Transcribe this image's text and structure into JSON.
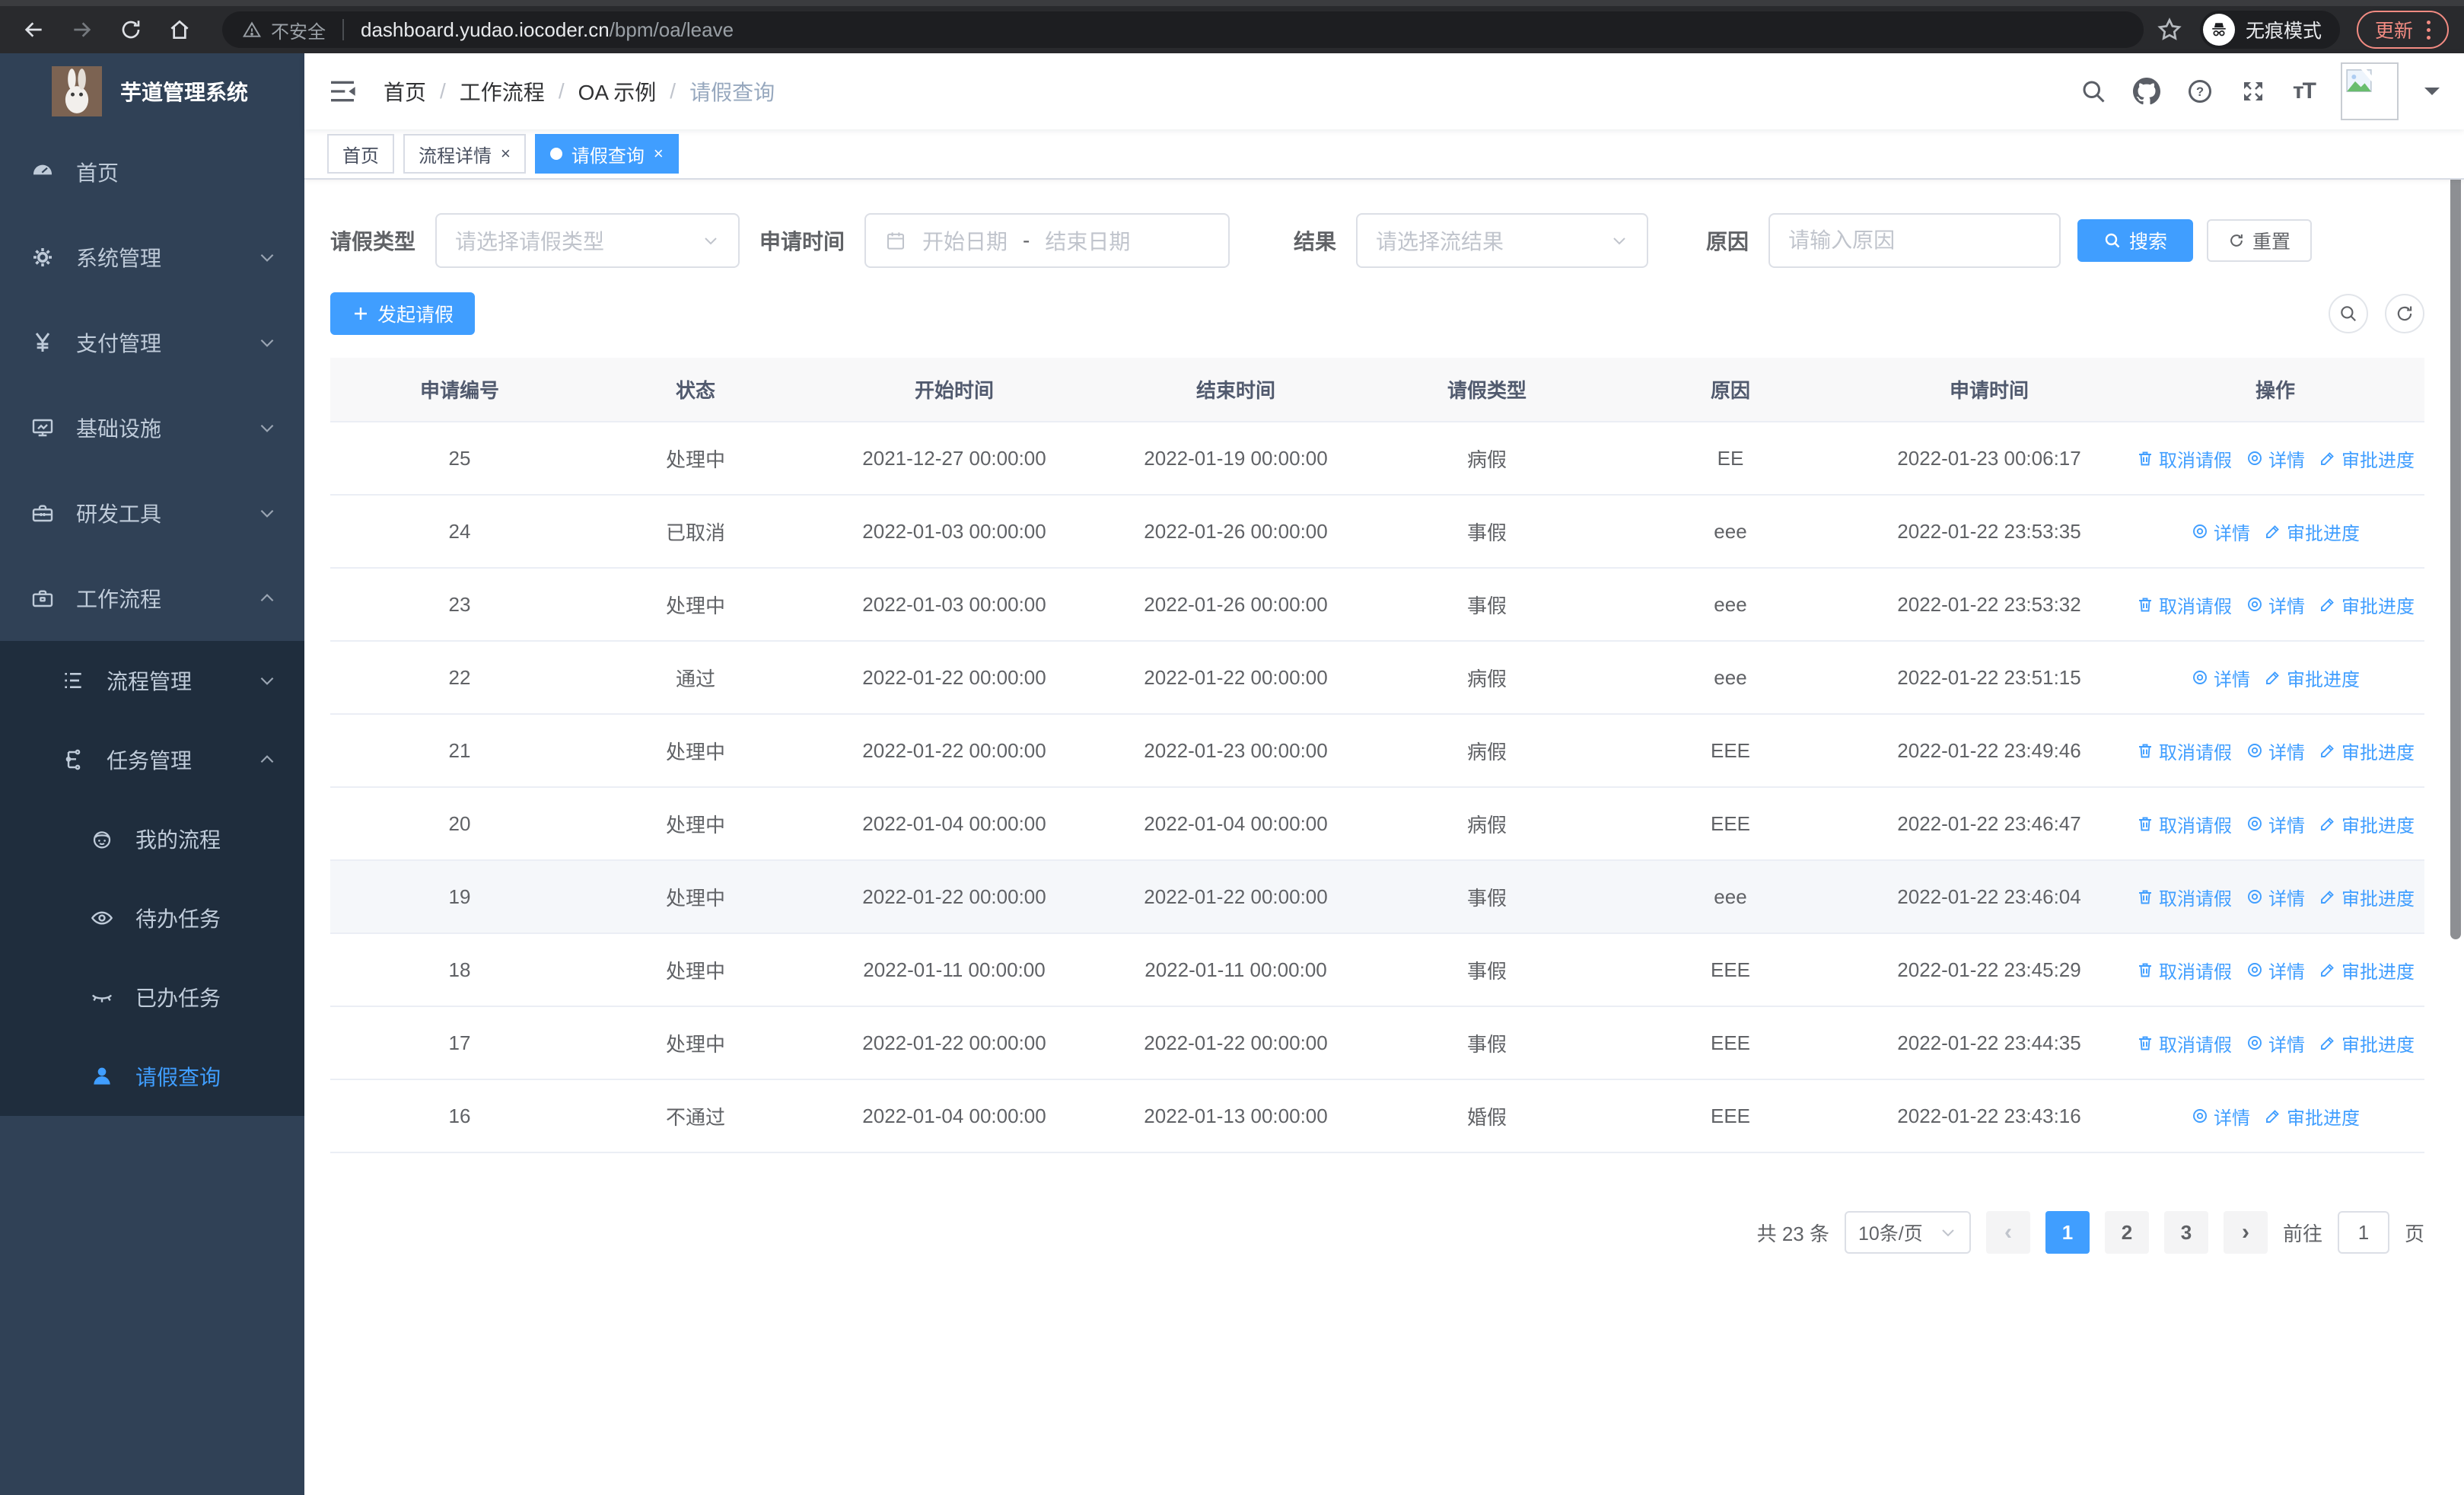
{
  "browser": {
    "security_label": "不安全",
    "url_host": "dashboard.yudao.iocoder.cn",
    "url_path": "/bpm/oa/leave",
    "incognito_label": "无痕模式",
    "update_label": "更新"
  },
  "sidebar": {
    "app_title": "芋道管理系统",
    "items": [
      {
        "label": "首页",
        "icon": "gauge",
        "level": 1,
        "chevron": "",
        "active": false
      },
      {
        "label": "系统管理",
        "icon": "gear",
        "level": 1,
        "chevron": "down",
        "active": false
      },
      {
        "label": "支付管理",
        "icon": "yen",
        "level": 1,
        "chevron": "down",
        "active": false
      },
      {
        "label": "基础设施",
        "icon": "monitor",
        "level": 1,
        "chevron": "down",
        "active": false
      },
      {
        "label": "研发工具",
        "icon": "toolbox",
        "level": 1,
        "chevron": "down",
        "active": false
      },
      {
        "label": "工作流程",
        "icon": "briefcase",
        "level": 1,
        "chevron": "up",
        "active": false
      },
      {
        "label": "流程管理",
        "icon": "list",
        "level": 2,
        "chevron": "down",
        "active": false
      },
      {
        "label": "任务管理",
        "icon": "tree",
        "level": 2,
        "chevron": "up",
        "active": false
      },
      {
        "label": "我的流程",
        "icon": "robot",
        "level": 3,
        "chevron": "",
        "active": false
      },
      {
        "label": "待办任务",
        "icon": "eye",
        "level": 3,
        "chevron": "",
        "active": false
      },
      {
        "label": "已办任务",
        "icon": "eye-closed",
        "level": 3,
        "chevron": "",
        "active": false
      },
      {
        "label": "请假查询",
        "icon": "user",
        "level": 3,
        "chevron": "",
        "active": true
      }
    ]
  },
  "breadcrumb": [
    "首页",
    "工作流程",
    "OA 示例",
    "请假查询"
  ],
  "tabs": [
    {
      "label": "首页",
      "closable": false,
      "active": false
    },
    {
      "label": "流程详情",
      "closable": true,
      "active": false
    },
    {
      "label": "请假查询",
      "closable": true,
      "active": true
    }
  ],
  "filters": {
    "leave_type_label": "请假类型",
    "leave_type_placeholder": "请选择请假类型",
    "apply_time_label": "申请时间",
    "date_start_placeholder": "开始日期",
    "date_separator": "-",
    "date_end_placeholder": "结束日期",
    "result_label": "结果",
    "result_placeholder": "请选择流结果",
    "reason_label": "原因",
    "reason_placeholder": "请输入原因",
    "search_label": "搜索",
    "reset_label": "重置"
  },
  "toolbar": {
    "create_label": "发起请假"
  },
  "table": {
    "columns": [
      "申请编号",
      "状态",
      "开始时间",
      "结束时间",
      "请假类型",
      "原因",
      "申请时间",
      "操作"
    ],
    "action_defs": {
      "cancel": {
        "label": "取消请假",
        "icon": "trash"
      },
      "detail": {
        "label": "详情",
        "icon": "view"
      },
      "progress": {
        "label": "审批进度",
        "icon": "pen"
      }
    },
    "rows": [
      {
        "id": "25",
        "status": "处理中",
        "start": "2021-12-27 00:00:00",
        "end": "2022-01-19 00:00:00",
        "type": "病假",
        "reason": "EE",
        "applied": "2022-01-23 00:06:17",
        "actions": [
          "cancel",
          "detail",
          "progress"
        ],
        "highlight": false
      },
      {
        "id": "24",
        "status": "已取消",
        "start": "2022-01-03 00:00:00",
        "end": "2022-01-26 00:00:00",
        "type": "事假",
        "reason": "eee",
        "applied": "2022-01-22 23:53:35",
        "actions": [
          "detail",
          "progress"
        ],
        "highlight": false
      },
      {
        "id": "23",
        "status": "处理中",
        "start": "2022-01-03 00:00:00",
        "end": "2022-01-26 00:00:00",
        "type": "事假",
        "reason": "eee",
        "applied": "2022-01-22 23:53:32",
        "actions": [
          "cancel",
          "detail",
          "progress"
        ],
        "highlight": false
      },
      {
        "id": "22",
        "status": "通过",
        "start": "2022-01-22 00:00:00",
        "end": "2022-01-22 00:00:00",
        "type": "病假",
        "reason": "eee",
        "applied": "2022-01-22 23:51:15",
        "actions": [
          "detail",
          "progress"
        ],
        "highlight": false
      },
      {
        "id": "21",
        "status": "处理中",
        "start": "2022-01-22 00:00:00",
        "end": "2022-01-23 00:00:00",
        "type": "病假",
        "reason": "EEE",
        "applied": "2022-01-22 23:49:46",
        "actions": [
          "cancel",
          "detail",
          "progress"
        ],
        "highlight": false
      },
      {
        "id": "20",
        "status": "处理中",
        "start": "2022-01-04 00:00:00",
        "end": "2022-01-04 00:00:00",
        "type": "病假",
        "reason": "EEE",
        "applied": "2022-01-22 23:46:47",
        "actions": [
          "cancel",
          "detail",
          "progress"
        ],
        "highlight": false
      },
      {
        "id": "19",
        "status": "处理中",
        "start": "2022-01-22 00:00:00",
        "end": "2022-01-22 00:00:00",
        "type": "事假",
        "reason": "eee",
        "applied": "2022-01-22 23:46:04",
        "actions": [
          "cancel",
          "detail",
          "progress"
        ],
        "highlight": true
      },
      {
        "id": "18",
        "status": "处理中",
        "start": "2022-01-11 00:00:00",
        "end": "2022-01-11 00:00:00",
        "type": "事假",
        "reason": "EEE",
        "applied": "2022-01-22 23:45:29",
        "actions": [
          "cancel",
          "detail",
          "progress"
        ],
        "highlight": false
      },
      {
        "id": "17",
        "status": "处理中",
        "start": "2022-01-22 00:00:00",
        "end": "2022-01-22 00:00:00",
        "type": "事假",
        "reason": "EEE",
        "applied": "2022-01-22 23:44:35",
        "actions": [
          "cancel",
          "detail",
          "progress"
        ],
        "highlight": false
      },
      {
        "id": "16",
        "status": "不通过",
        "start": "2022-01-04 00:00:00",
        "end": "2022-01-13 00:00:00",
        "type": "婚假",
        "reason": "EEE",
        "applied": "2022-01-22 23:43:16",
        "actions": [
          "detail",
          "progress"
        ],
        "highlight": false
      }
    ]
  },
  "pagination": {
    "total": "共 23 条",
    "page_size": "10条/页",
    "prev": "‹",
    "next": "›",
    "pages": [
      "1",
      "2",
      "3"
    ],
    "active_page": "1",
    "goto_label": "前往",
    "goto_value": "1",
    "goto_unit": "页"
  },
  "colors": {
    "accent": "#409eff",
    "sidebar_bg": "#304156",
    "submenu_bg": "#1f2d3d"
  }
}
